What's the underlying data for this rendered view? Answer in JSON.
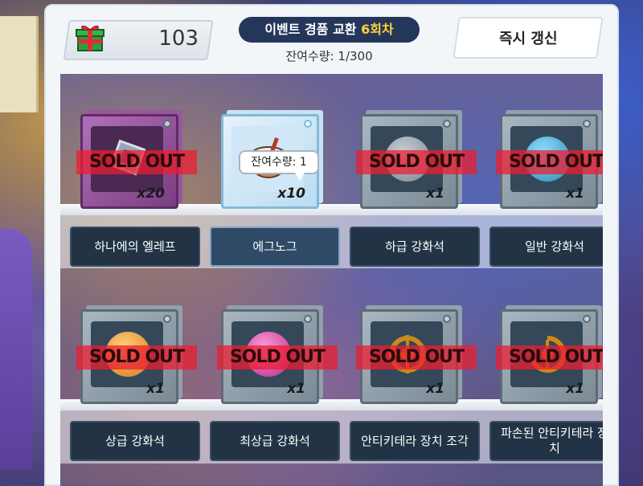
{
  "currency": {
    "icon": "gift-box-icon",
    "amount": "103"
  },
  "event": {
    "title_prefix": "이벤트 경품 교환",
    "round": "6회차",
    "remaining": "잔여수량: 1/300"
  },
  "refresh_label": "즉시 갱신",
  "tooltip": "잔여수량: 1",
  "sold_out_text": "SOLD OUT",
  "colors": {
    "sold_out_red": "#eb1e32",
    "round_yellow": "#ffd23a",
    "label_navy": "#223345"
  },
  "items": [
    {
      "name": "하나에의 엘레프",
      "qty": "x20",
      "sold_out": true,
      "icon": "crystal-frame-icon"
    },
    {
      "name": "에그노그",
      "qty": "x10",
      "sold_out": false,
      "icon": "eggnog-glass-icon"
    },
    {
      "name": "하급 강화석",
      "qty": "x1",
      "sold_out": true,
      "icon": "gray-orb-icon"
    },
    {
      "name": "일반 강화석",
      "qty": "x1",
      "sold_out": true,
      "icon": "blue-orb-icon"
    },
    {
      "name": "상급 강화석",
      "qty": "x1",
      "sold_out": true,
      "icon": "orange-orb-icon"
    },
    {
      "name": "최상급 강화석",
      "qty": "x1",
      "sold_out": true,
      "icon": "pink-orb-icon"
    },
    {
      "name": "안티키테라 장치 조각",
      "qty": "x1",
      "sold_out": true,
      "icon": "gear-fragment-icon"
    },
    {
      "name": "파손된 안티키테라 장치",
      "qty": "x1",
      "sold_out": true,
      "icon": "broken-gear-icon"
    }
  ]
}
